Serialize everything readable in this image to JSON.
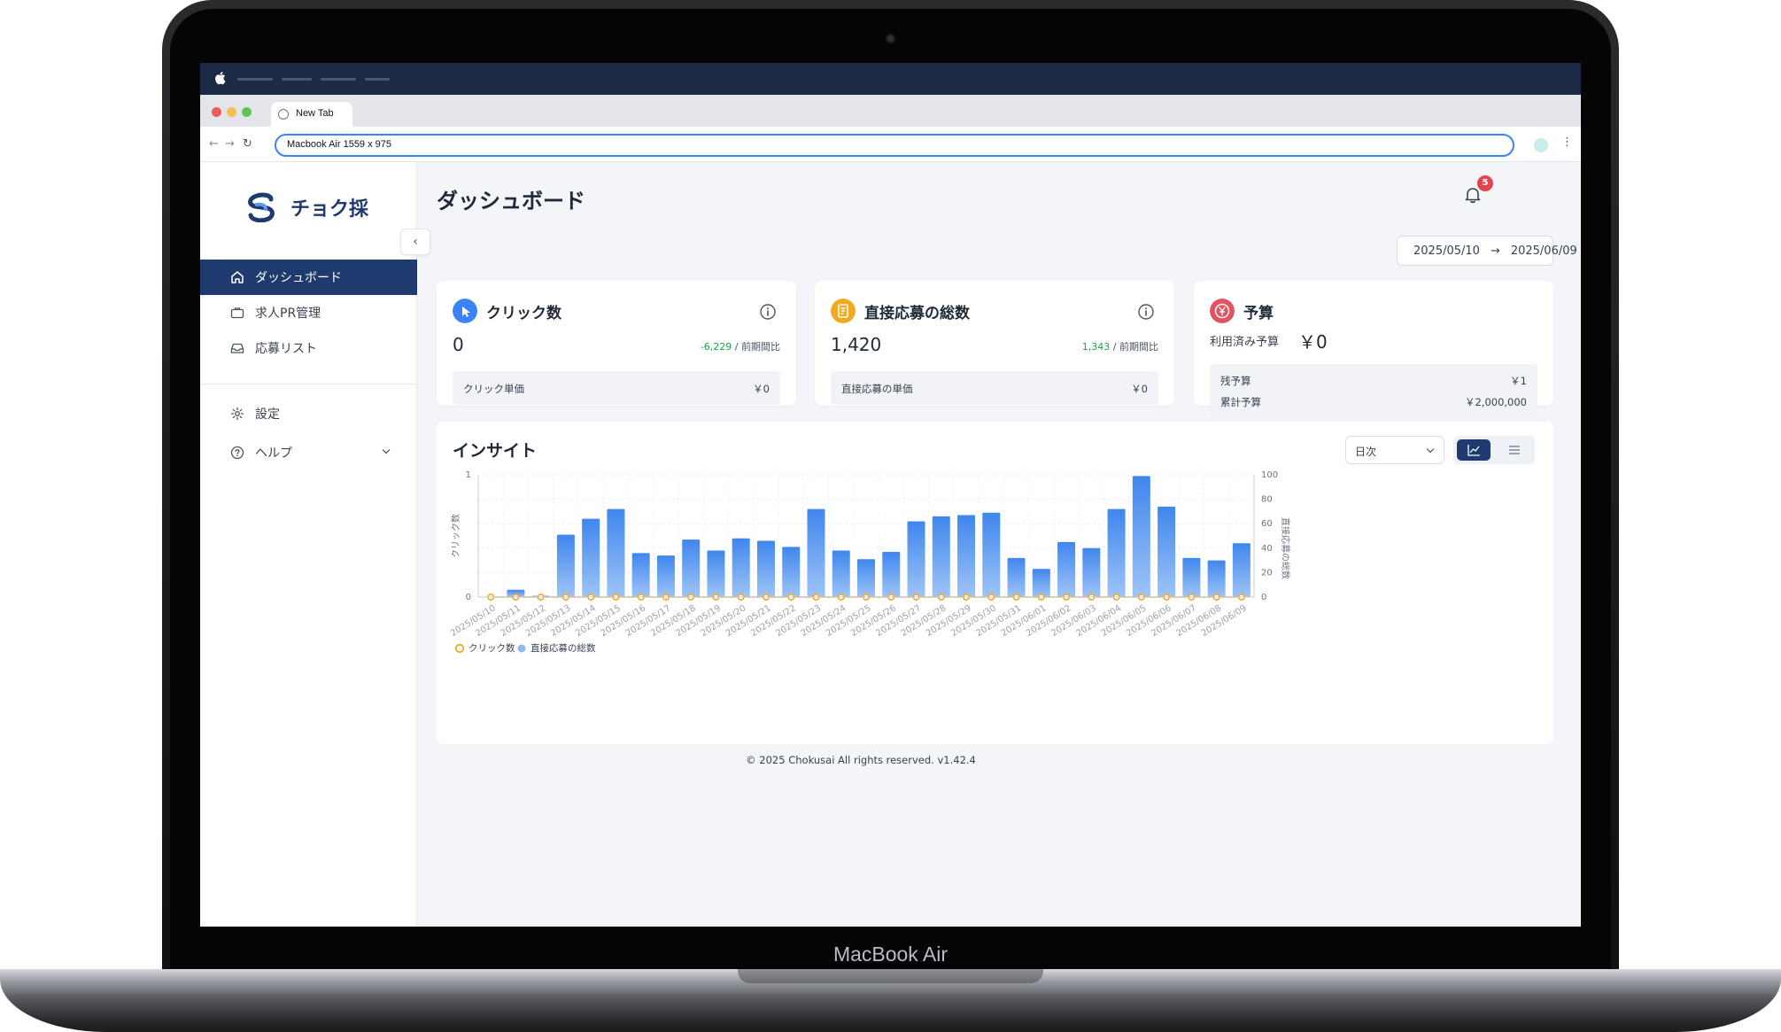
{
  "device": {
    "label": "MacBook Air"
  },
  "browser": {
    "tab_title": "New Tab",
    "address": "Macbook Air   1559 x 975"
  },
  "app": {
    "brand": "チョク採",
    "sidebar": {
      "items": [
        {
          "label": "ダッシュボード",
          "icon": "home-icon",
          "active": true
        },
        {
          "label": "求人PR管理",
          "icon": "briefcase-icon",
          "active": false
        },
        {
          "label": "応募リスト",
          "icon": "inbox-icon",
          "active": false
        },
        {
          "label": "設定",
          "icon": "gear-icon",
          "active": false
        },
        {
          "label": "ヘルプ",
          "icon": "question-icon",
          "active": false
        }
      ]
    },
    "header": {
      "title": "ダッシュボード",
      "notification_count": "5"
    },
    "date_range": {
      "start": "2025/05/10",
      "end": "2025/06/09"
    },
    "cards": {
      "clicks": {
        "title": "クリック数",
        "value": "0",
        "delta": "-6,229",
        "delta_suffix": " / 前期間比",
        "sub_label": "クリック単価",
        "sub_value": "￥0"
      },
      "applications": {
        "title": "直接応募の総数",
        "value": "1,420",
        "delta": "1,343",
        "delta_suffix": " / 前期間比",
        "sub_label": "直接応募の単価",
        "sub_value": "￥0"
      },
      "budget": {
        "title": "予算",
        "used_label": "利用済み予算",
        "used_value": "￥0",
        "remaining_label": "残予算",
        "remaining_value": "￥1",
        "total_label": "累計予算",
        "total_value": "￥2,000,000"
      }
    },
    "insight": {
      "title": "インサイト",
      "period": "日次"
    },
    "footer": "© 2025 Chokusai All rights reserved. v1.42.4"
  },
  "colors": {
    "primary": "#1e3a6e",
    "bar": "#5b9bf0",
    "line": "#f5a623",
    "delta_positive": "#16a34a",
    "badge": "#e0464d"
  },
  "chart_data": {
    "type": "bar",
    "categories": [
      "2025/05/10",
      "2025/05/11",
      "2025/05/12",
      "2025/05/13",
      "2025/05/14",
      "2025/05/15",
      "2025/05/16",
      "2025/05/17",
      "2025/05/18",
      "2025/05/19",
      "2025/05/20",
      "2025/05/21",
      "2025/05/22",
      "2025/05/23",
      "2025/05/24",
      "2025/05/25",
      "2025/05/26",
      "2025/05/27",
      "2025/05/28",
      "2025/05/29",
      "2025/05/30",
      "2025/05/31",
      "2025/06/01",
      "2025/06/02",
      "2025/06/03",
      "2025/06/04",
      "2025/06/05",
      "2025/06/06",
      "2025/06/07",
      "2025/06/08",
      "2025/06/09"
    ],
    "series": [
      {
        "name": "直接応募の総数",
        "axis": "right",
        "kind": "bar",
        "values": [
          0,
          6,
          1,
          51,
          64,
          72,
          36,
          34,
          47,
          38,
          48,
          46,
          41,
          72,
          38,
          31,
          37,
          62,
          66,
          67,
          69,
          32,
          23,
          45,
          40,
          72,
          99,
          74,
          32,
          30,
          44
        ]
      },
      {
        "name": "クリック数",
        "axis": "left",
        "kind": "line",
        "values": [
          0,
          0,
          0,
          0,
          0,
          0,
          0,
          0,
          0,
          0,
          0,
          0,
          0,
          0,
          0,
          0,
          0,
          0,
          0,
          0,
          0,
          0,
          0,
          0,
          0,
          0,
          0,
          0,
          0,
          0,
          0
        ]
      }
    ],
    "ylabel_left": "クリック数",
    "ylabel_right": "直接応募の総数",
    "ylim_left": [
      0,
      1
    ],
    "yticks_left": [
      "0",
      "1"
    ],
    "ylim_right": [
      0,
      100
    ],
    "yticks_right": [
      "0",
      "20",
      "40",
      "60",
      "80",
      "100"
    ],
    "grid": true,
    "legend": "bottom-left"
  }
}
